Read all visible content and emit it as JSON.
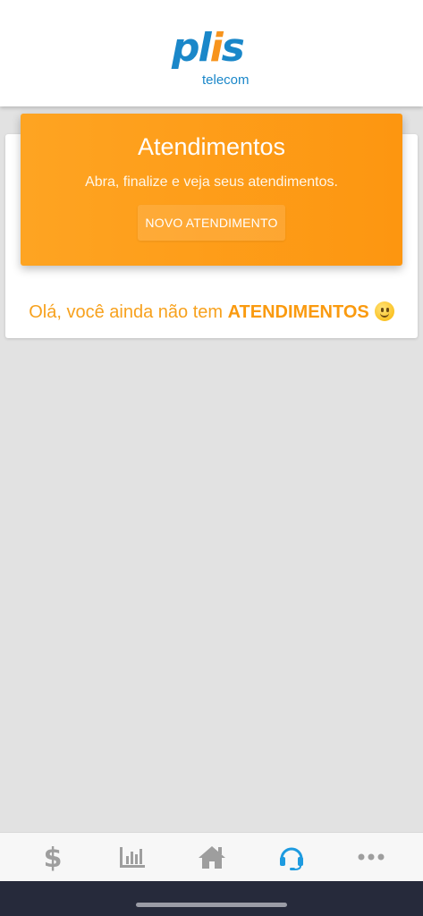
{
  "header": {
    "logo": {
      "brand_part1": "pl",
      "brand_part2": "i",
      "brand_part3": "s",
      "tagline": "telecom"
    }
  },
  "banner": {
    "title": "Atendimentos",
    "subtitle": "Abra, finalize e veja seus atendimentos.",
    "new_button_label": "NOVO ATENDIMENTO"
  },
  "empty_state": {
    "message_prefix": "Olá, você ainda não tem",
    "message_highlight": "ATENDIMENTOS",
    "emoji": "slightly-smiling-face"
  },
  "bottom_nav": {
    "items": [
      {
        "icon": "dollar-icon",
        "active": false
      },
      {
        "icon": "bar-chart-icon",
        "active": false
      },
      {
        "icon": "home-icon",
        "active": false
      },
      {
        "icon": "headset-icon",
        "active": true
      },
      {
        "icon": "more-icon",
        "active": false
      }
    ]
  },
  "colors": {
    "brand_blue": "#1a87c9",
    "brand_orange": "#f7941d",
    "banner_orange": "#fd9610",
    "nav_icon": "#9e9e9e",
    "nav_active": "#1e9be0"
  }
}
